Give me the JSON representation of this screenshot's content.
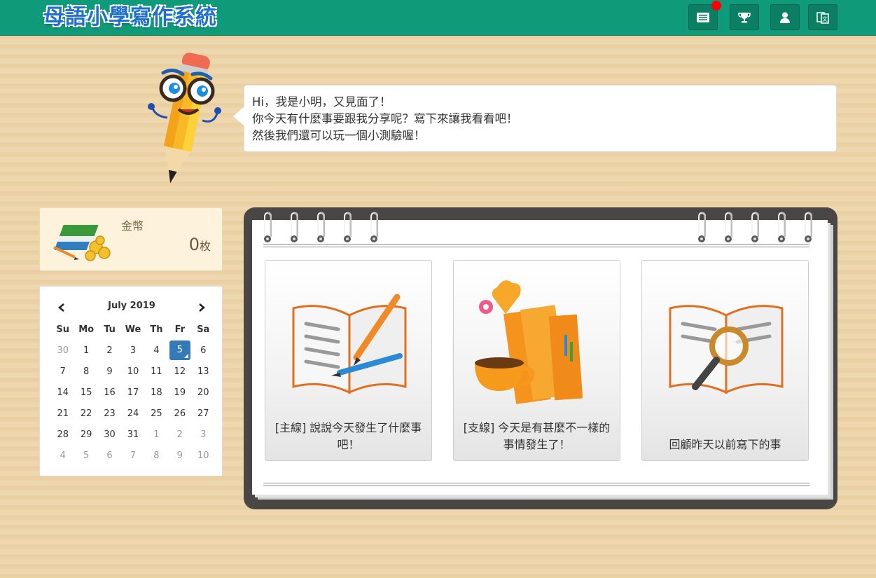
{
  "header": {
    "title": "母語小學寫作系統",
    "bg_color": "#0f9a7a",
    "buttons": [
      {
        "icon": "list-icon",
        "has_notification": true
      },
      {
        "icon": "trophy-icon",
        "has_notification": false
      },
      {
        "icon": "user-icon",
        "has_notification": false
      },
      {
        "icon": "language-icon",
        "has_notification": false
      }
    ]
  },
  "mascot": {
    "lines": [
      "Hi，我是小明，又見面了！",
      "你今天有什麼事要跟我分享呢？寫下來讓我看看吧！",
      "然後我們還可以玩一個小測驗喔！"
    ]
  },
  "coins": {
    "label": "金幣",
    "amount": "0",
    "unit": "枚"
  },
  "calendar": {
    "month_label": "July 2019",
    "weekdays": [
      "Su",
      "Mo",
      "Tu",
      "We",
      "Th",
      "Fr",
      "Sa"
    ],
    "weeks": [
      [
        "30",
        "1",
        "2",
        "3",
        "4",
        "5",
        "6"
      ],
      [
        "7",
        "8",
        "9",
        "10",
        "11",
        "12",
        "13"
      ],
      [
        "14",
        "15",
        "16",
        "17",
        "18",
        "19",
        "20"
      ],
      [
        "21",
        "22",
        "23",
        "24",
        "25",
        "26",
        "27"
      ],
      [
        "28",
        "29",
        "30",
        "31",
        "1",
        "2",
        "3"
      ],
      [
        "4",
        "5",
        "6",
        "7",
        "8",
        "9",
        "10"
      ]
    ],
    "selected_day": "5",
    "accent": "#337ab7"
  },
  "cards": [
    {
      "label": "[主線] 說說今天發生了什麼事吧！",
      "icon": "book-pencil-icon"
    },
    {
      "label": "[支線] 今天是有甚麼不一樣的事情發生了！",
      "icon": "books-coffee-icon"
    },
    {
      "label": "回顧昨天以前寫下的事",
      "icon": "book-magnifier-icon"
    }
  ]
}
